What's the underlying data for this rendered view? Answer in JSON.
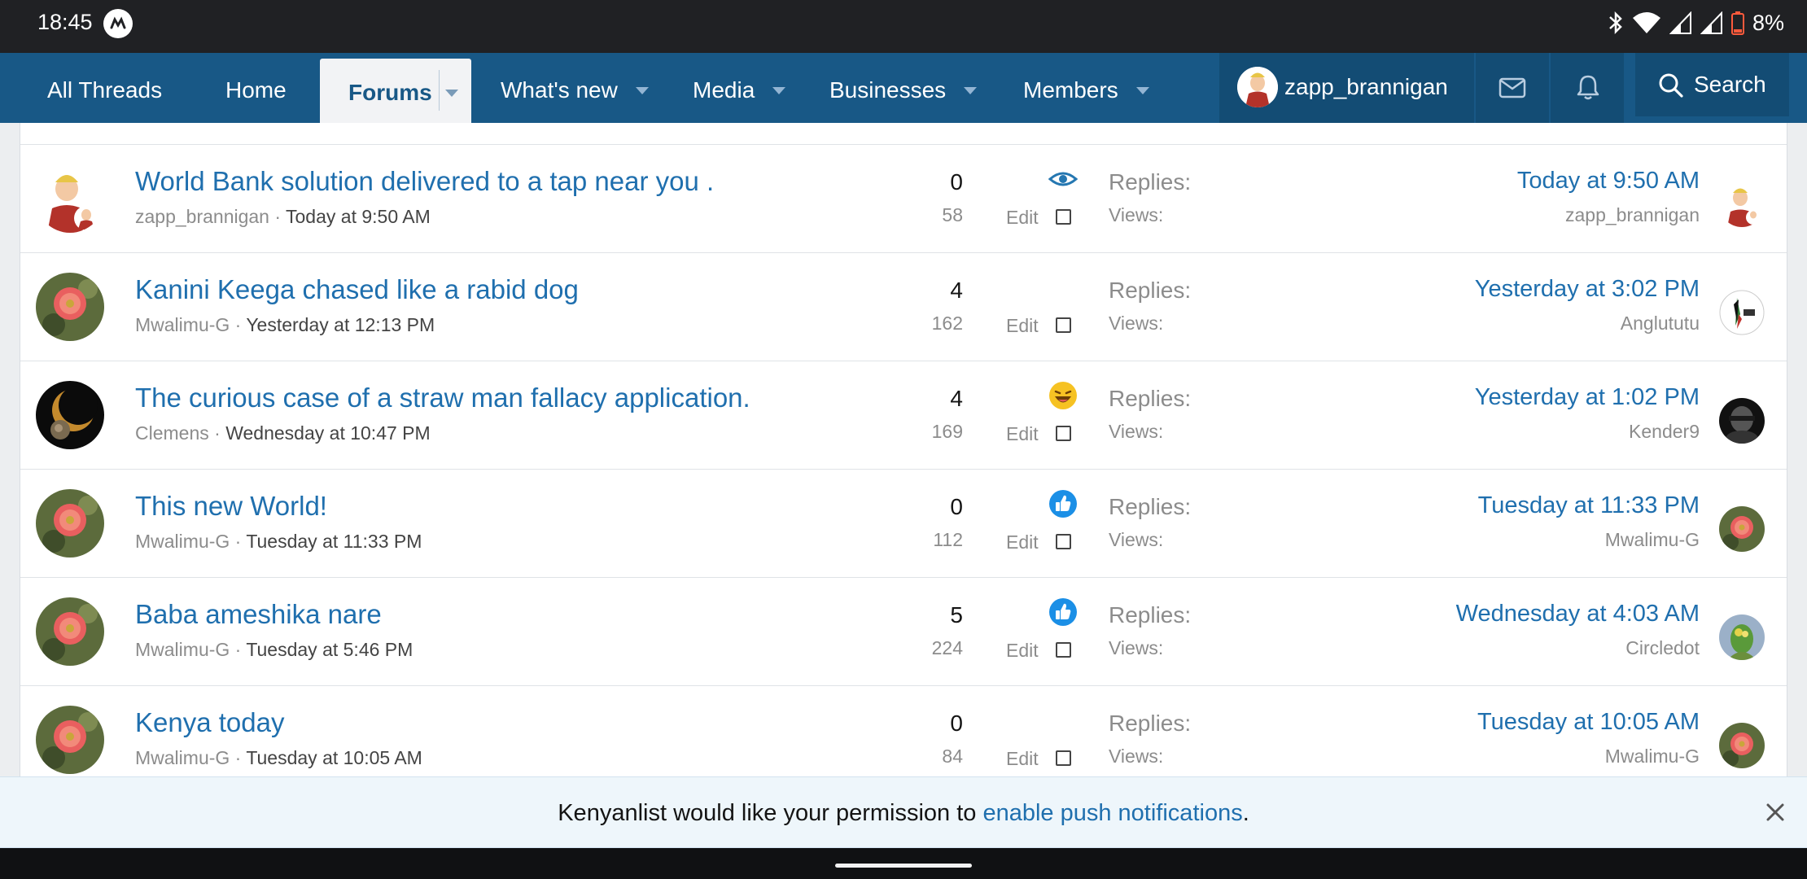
{
  "status_bar": {
    "time": "18:45",
    "battery": "8%"
  },
  "nav": {
    "items": [
      {
        "label": "All Threads"
      },
      {
        "label": "Home"
      },
      {
        "label": "Forums"
      },
      {
        "label": "What's new"
      },
      {
        "label": "Media"
      },
      {
        "label": "Businesses"
      },
      {
        "label": "Members"
      }
    ],
    "user": "zapp_brannigan",
    "search": "Search"
  },
  "threads": [
    {
      "title": "World Bank solution delivered to a tap near you .",
      "author": "zapp_brannigan",
      "date": "Today at 9:50 AM",
      "reaction": "eye-icon",
      "edit": "Edit",
      "replies_label": "Replies:",
      "replies": "0",
      "views_label": "Views:",
      "views": "58",
      "last_date": "Today at 9:50 AM",
      "last_user": "zapp_brannigan"
    },
    {
      "title": "Kanini Keega chased like a rabid dog",
      "author": "Mwalimu-G",
      "date": "Yesterday at 12:13 PM",
      "reaction": "",
      "edit": "Edit",
      "replies_label": "Replies:",
      "replies": "4",
      "views_label": "Views:",
      "views": "162",
      "last_date": "Yesterday at 3:02 PM",
      "last_user": "Anglututu"
    },
    {
      "title": "The curious case of a straw man fallacy application.",
      "author": "Clemens",
      "date": "Wednesday at 10:47 PM",
      "reaction": "laugh-icon",
      "edit": "Edit",
      "replies_label": "Replies:",
      "replies": "4",
      "views_label": "Views:",
      "views": "169",
      "last_date": "Yesterday at 1:02 PM",
      "last_user": "Kender9"
    },
    {
      "title": "This new World!",
      "author": "Mwalimu-G",
      "date": "Tuesday at 11:33 PM",
      "reaction": "like-icon",
      "edit": "Edit",
      "replies_label": "Replies:",
      "replies": "0",
      "views_label": "Views:",
      "views": "112",
      "last_date": "Tuesday at 11:33 PM",
      "last_user": "Mwalimu-G"
    },
    {
      "title": "Baba ameshika nare",
      "author": "Mwalimu-G",
      "date": "Tuesday at 5:46 PM",
      "reaction": "like-icon",
      "edit": "Edit",
      "replies_label": "Replies:",
      "replies": "5",
      "views_label": "Views:",
      "views": "224",
      "last_date": "Wednesday at 4:03 AM",
      "last_user": "Circledot"
    },
    {
      "title": "Kenya today",
      "author": "Mwalimu-G",
      "date": "Tuesday at 10:05 AM",
      "reaction": "",
      "edit": "Edit",
      "replies_label": "Replies:",
      "replies": "0",
      "views_label": "Views:",
      "views": "84",
      "last_date": "Tuesday at 10:05 AM",
      "last_user": "Mwalimu-G"
    }
  ],
  "push_banner": {
    "before": "Kenyanlist would like your permission to ",
    "link": "enable push notifications",
    "after": "."
  },
  "colors": {
    "nav_bg": "#185886",
    "link": "#1f6fae",
    "banner_bg": "#eef6fb"
  }
}
